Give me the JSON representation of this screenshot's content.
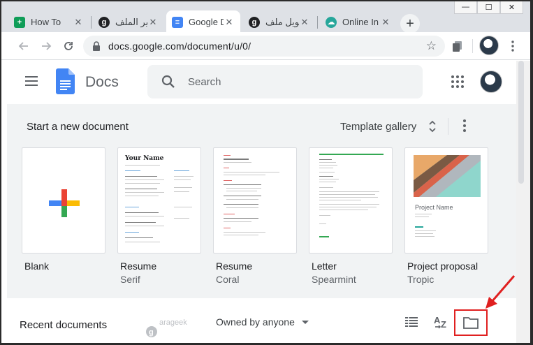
{
  "browser": {
    "tabs": [
      {
        "label": "How To",
        "favicon": "sheets-icon",
        "color": "#0f9d58",
        "active": false
      },
      {
        "label": "تحرير الملف",
        "favicon": "arageek-icon",
        "color": "#202124",
        "active": false
      },
      {
        "label": "Google D",
        "favicon": "docs-icon",
        "color": "#4285f4",
        "active": true
      },
      {
        "label": "تحويل ملف",
        "favicon": "arageek-icon",
        "color": "#202124",
        "active": false
      },
      {
        "label": "Online In",
        "favicon": "cloud-icon",
        "color": "#26a69a",
        "active": false
      }
    ],
    "new_tab": "+",
    "window_controls": {
      "minimize": "—",
      "maximize": "☐",
      "close": "✕"
    },
    "url": "docs.google.com/document/u/0/"
  },
  "docs": {
    "title": "Docs",
    "search_placeholder": "Search",
    "accent": "#4285f4"
  },
  "gallery": {
    "title": "Start a new document",
    "link": "Template gallery",
    "templates": [
      {
        "name": "Blank",
        "sub": ""
      },
      {
        "name": "Resume",
        "sub": "Serif",
        "heading": "Your Name"
      },
      {
        "name": "Resume",
        "sub": "Coral"
      },
      {
        "name": "Letter",
        "sub": "Spearmint"
      },
      {
        "name": "Project proposal",
        "sub": "Tropic",
        "heading": "Project Name"
      }
    ]
  },
  "recent": {
    "title": "Recent documents",
    "filter": "Owned by anyone"
  },
  "highlight_color": "#e02020",
  "watermark": {
    "text": "arageek"
  }
}
